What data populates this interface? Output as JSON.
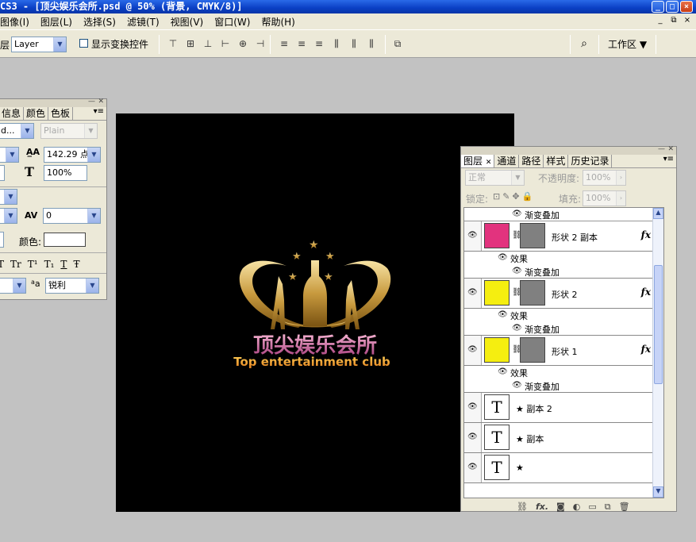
{
  "title": "CS3 - [顶尖娱乐会所.psd @ 50% (背景, CMYK/8)]",
  "window_buttons": [
    "_",
    "□",
    "×"
  ],
  "menu": [
    "图像(I)",
    "图层(L)",
    "选择(S)",
    "滤镜(T)",
    "视图(V)",
    "窗口(W)",
    "帮助(H)"
  ],
  "mdi_buttons": [
    "_",
    "⧉",
    "×"
  ],
  "options": {
    "layer_label": "层",
    "layer_select": "Layer",
    "show_transform_label": "显示变换控件",
    "workspace_label": "工作区"
  },
  "char_panel": {
    "tabs": [
      "信息",
      "颜色",
      "色板"
    ],
    "font_family": "d...",
    "font_style": "Plain",
    "leading_value": "142.29 点",
    "vscale_value": "100%",
    "tracking_value": "0",
    "color_label": "颜色:",
    "antialias_label": "a",
    "antialias_value": "锐利",
    "style_buttons": [
      "T",
      "Tr",
      "T¹",
      "T₁",
      "T",
      "Ŧ"
    ]
  },
  "layers_panel": {
    "tabs": [
      "图层",
      "通道",
      "路径",
      "样式",
      "历史记录"
    ],
    "blend_mode": "正常",
    "opacity_label": "不透明度:",
    "opacity_value": "100%",
    "lock_label": "锁定:",
    "fill_label": "填充:",
    "fill_value": "100%",
    "rows": {
      "top_effect": "渐变叠加",
      "shape2copy": "形状 2 副本",
      "shape2copy_effects": "效果",
      "shape2copy_gradient": "渐变叠加",
      "shape2": "形状 2",
      "shape2_effects": "效果",
      "shape2_gradient": "渐变叠加",
      "shape1": "形状 1",
      "shape1_effects": "效果",
      "shape1_gradient": "渐变叠加",
      "text_copy2": "★ 副本 2",
      "text_copy": "★ 副本",
      "text_star": "★",
      "fx": "fx",
      "text_thumb": "T"
    },
    "colors": {
      "shape2copy": "#e2337e",
      "shape2": "#f5ee10",
      "shape1": "#f5ee10"
    }
  },
  "logo": {
    "chinese": "顶尖娱乐会所",
    "english": "Top entertainment club"
  }
}
